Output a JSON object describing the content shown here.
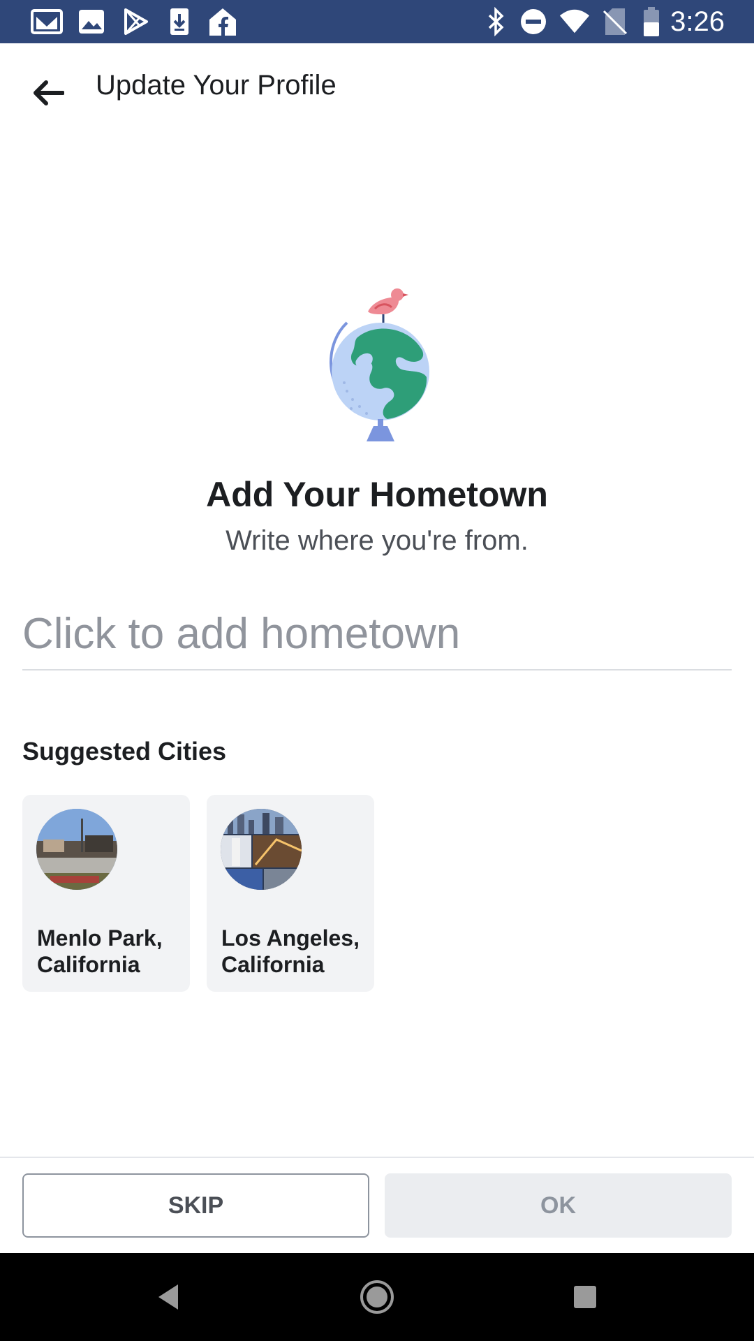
{
  "status_bar": {
    "time": "3:26",
    "left_icons": [
      "gmail-icon",
      "photos-icon",
      "play-store-icon",
      "download-icon",
      "facebook-home-icon"
    ],
    "right_icons": [
      "bluetooth-icon",
      "do-not-disturb-icon",
      "wifi-icon",
      "no-sim-icon",
      "battery-icon"
    ],
    "background": "#2f4779"
  },
  "header": {
    "back_icon": "arrow-left-icon",
    "title": "Update Your Profile"
  },
  "main": {
    "illustration": "globe-with-bird-illustration",
    "title": "Add Your Hometown",
    "subtitle": "Write where you're from.",
    "input": {
      "placeholder": "Click to add hometown",
      "value": ""
    },
    "suggested_label": "Suggested Cities",
    "cities": [
      {
        "name": "Menlo Park, California"
      },
      {
        "name": "Los Angeles, California"
      }
    ]
  },
  "footer": {
    "skip_label": "SKIP",
    "ok_label": "OK"
  },
  "nav_bar": {
    "icons": [
      "back-triangle-icon",
      "home-circle-icon",
      "recents-square-icon"
    ]
  },
  "colors": {
    "accent": "#2f4779",
    "text_primary": "#1c1e21",
    "text_secondary": "#4b4f56",
    "placeholder": "#90949c",
    "card_bg": "#f2f3f5",
    "globe_green": "#2e9e78",
    "globe_blue": "#bcd3f6",
    "bird_pink": "#ee8a94"
  }
}
